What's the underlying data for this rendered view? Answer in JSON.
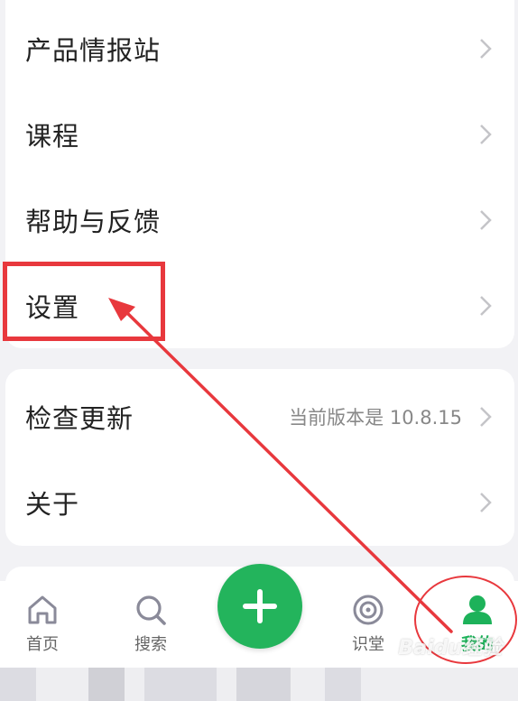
{
  "settings_list": {
    "items": [
      {
        "label": "产品情报站"
      },
      {
        "label": "课程"
      },
      {
        "label": "帮助与反馈"
      },
      {
        "label": "设置"
      }
    ]
  },
  "about_list": {
    "check_update": {
      "label": "检查更新",
      "value": "当前版本是 10.8.15"
    },
    "about": {
      "label": "关于"
    }
  },
  "bottom_nav": {
    "tabs": [
      {
        "label": "首页",
        "icon": "home-icon"
      },
      {
        "label": "搜索",
        "icon": "search-icon"
      },
      {
        "label": "识堂",
        "icon": "target-icon"
      },
      {
        "label": "我的",
        "icon": "person-icon"
      }
    ],
    "fab_icon": "plus-icon",
    "active_tab": "我的"
  },
  "watermark": "Baidu经验",
  "colors": {
    "accent": "#23b45c",
    "annotation": "#e8383d",
    "background": "#f2f2f5"
  }
}
